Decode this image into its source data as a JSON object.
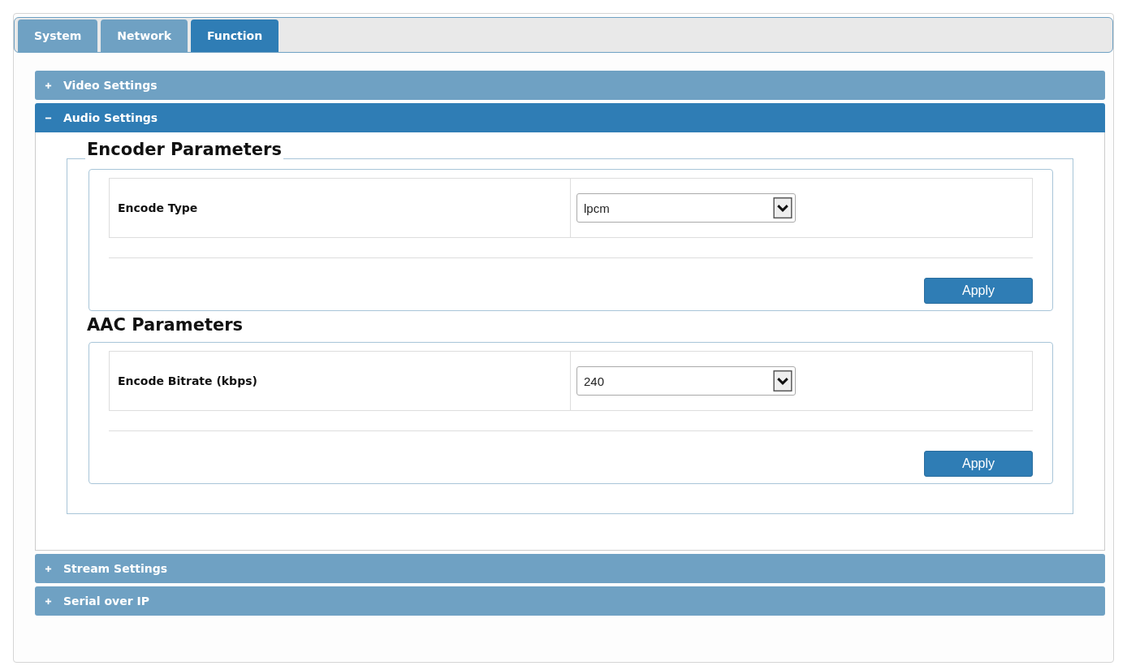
{
  "tabs": [
    {
      "label": "System",
      "selected": false
    },
    {
      "label": "Network",
      "selected": false
    },
    {
      "label": "Function",
      "selected": true
    }
  ],
  "sections": [
    {
      "title": "Video Settings",
      "expanded": false
    },
    {
      "title": "Audio Settings",
      "expanded": true,
      "groups": [
        {
          "legend": "Encoder Parameters",
          "field_label": "Encode Type",
          "value": "lpcm",
          "button": "Apply"
        },
        {
          "legend": "AAC Parameters",
          "field_label": "Encode Bitrate (kbps)",
          "value": "240",
          "button": "Apply"
        }
      ]
    },
    {
      "title": "Stream Settings",
      "expanded": false
    },
    {
      "title": "Serial over IP",
      "expanded": false
    }
  ]
}
